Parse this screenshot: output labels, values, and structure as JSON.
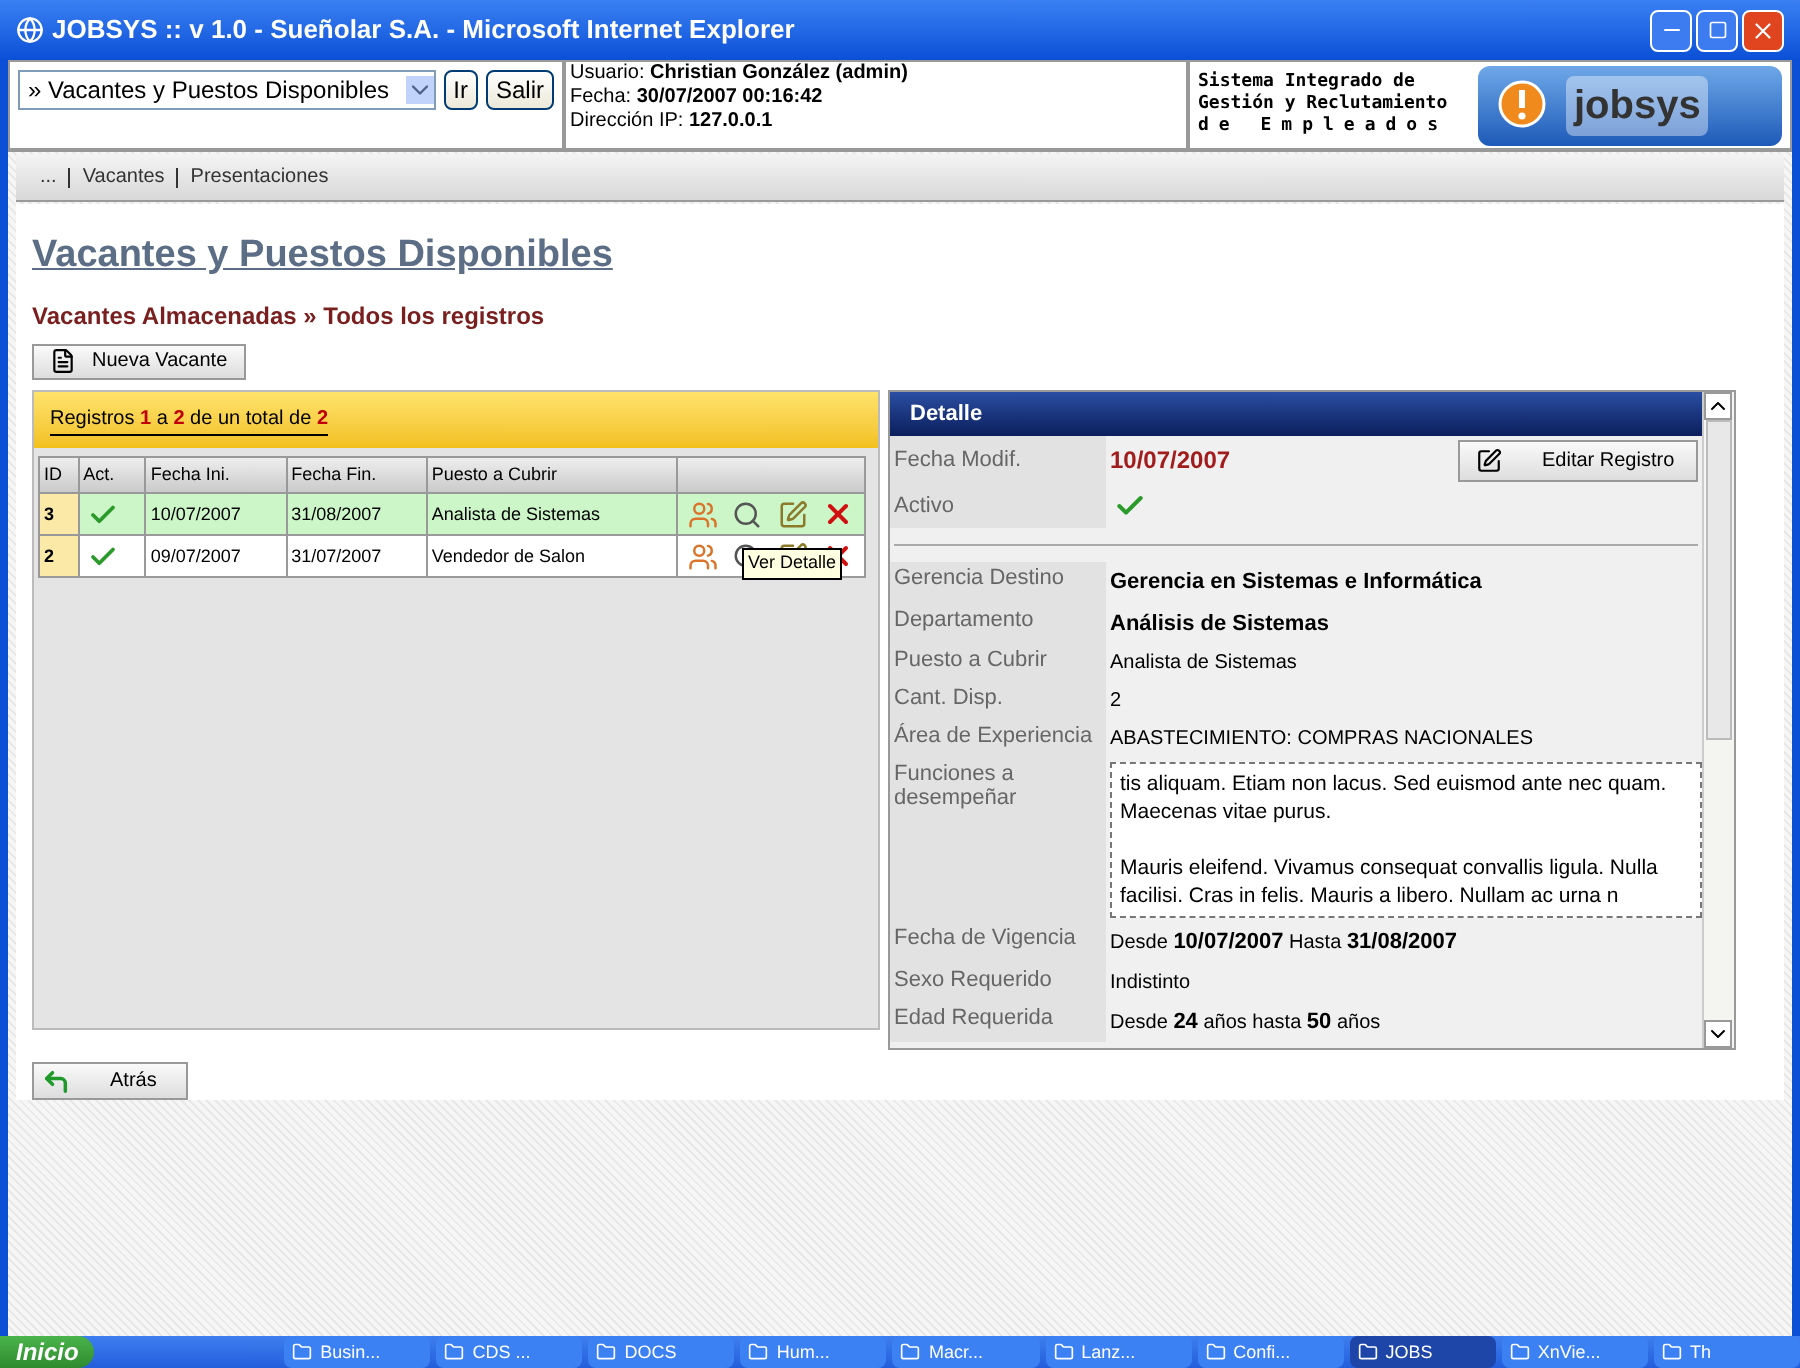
{
  "window": {
    "title": "JOBSYS :: v 1.0 - Sueñolar S.A. - Microsoft Internet Explorer"
  },
  "header": {
    "section_select": "» Vacantes y Puestos Disponibles",
    "buttons": [
      "Ir",
      "Salir"
    ],
    "user_info": [
      "Usuario: **Christian González (admin)**",
      "Fecha: **30/07/2007 00:16:42**",
      "Dirección IP: **127.0.0.1**"
    ],
    "system_name": [
      "Sistema Integrado de",
      "Gestión y Reclutamiento",
      "de Empleados"
    ],
    "logo_text": "jobsys"
  },
  "nav": [
    "...",
    "Vacantes",
    "Presentaciones"
  ],
  "page_title": "Vacantes y Puestos Disponibles",
  "breadcrumb": "Vacantes Almacenadas » Todos los registros",
  "new_button": "Nueva Vacante",
  "records_summary": "Registros **1** a **2** de un total de **2**",
  "table": {
    "columns": [
      "ID",
      "Act.",
      "Fecha Ini.",
      "Fecha Fin.",
      "Puesto a Cubrir"
    ],
    "rows": [
      {
        "id": "3",
        "active": true,
        "start": "10/07/2007",
        "end": "31/08/2007",
        "position": "Analista de Sistemas",
        "selected": true
      },
      {
        "id": "2",
        "active": true,
        "start": "09/07/2007",
        "end": "31/07/2007",
        "position": "Vendedor de Salon",
        "selected": false
      }
    ]
  },
  "tooltip": "Ver Detalle",
  "detail": {
    "title": "Detalle",
    "modified_label": "Fecha Modif.",
    "modified": "10/07/2007",
    "edit_button": "Editar Registro",
    "active_label": "Activo",
    "active": true,
    "fields": [
      {
        "label": "Gerencia Destino",
        "value": "Gerencia en Sistemas e Informática",
        "kind": "bold"
      },
      {
        "label": "Departamento",
        "value": "Análisis de Sistemas",
        "kind": "bold"
      },
      {
        "label": "Puesto a Cubrir",
        "value": "Analista de Sistemas",
        "kind": "plain"
      },
      {
        "label": "Cant. Disp.",
        "value": "2",
        "kind": "plain"
      },
      {
        "label": "Área de Experiencia",
        "value": "ABASTECIMIENTO: COMPRAS NACIONALES",
        "kind": "plain"
      },
      {
        "label": "Funciones a desempeñar",
        "paragraphs": [
          "tis aliquam. Etiam non lacus. Sed euismod ante nec quam. Maecenas vitae purus.",
          "Mauris eleifend. Vivamus consequat convallis ligula. Nulla facilisi. Cras in felis. Mauris a libero. Nullam ac urna n"
        ],
        "kind": "box"
      },
      {
        "label": "Fecha de Vigencia",
        "value": "Desde **10/07/2007** Hasta **31/08/2007**",
        "kind": "rich"
      },
      {
        "label": "Sexo Requerido",
        "value": "Indistinto",
        "kind": "plain"
      },
      {
        "label": "Edad Requerida",
        "value": "Desde **24** años hasta **50** años",
        "kind": "rich"
      }
    ]
  },
  "back_button": "Atrás",
  "taskbar": {
    "start": "Inicio",
    "tasks": [
      {
        "label": "Busin...",
        "selected": false
      },
      {
        "label": "CDS ...",
        "selected": false
      },
      {
        "label": "DOCS",
        "selected": false
      },
      {
        "label": "Hum...",
        "selected": false
      },
      {
        "label": "Macr...",
        "selected": false
      },
      {
        "label": "Lanz...",
        "selected": false
      },
      {
        "label": "Confi...",
        "selected": false
      },
      {
        "label": "JOBS",
        "selected": true
      },
      {
        "label": "XnVie...",
        "selected": false
      },
      {
        "label": "Th",
        "selected": false
      }
    ]
  }
}
